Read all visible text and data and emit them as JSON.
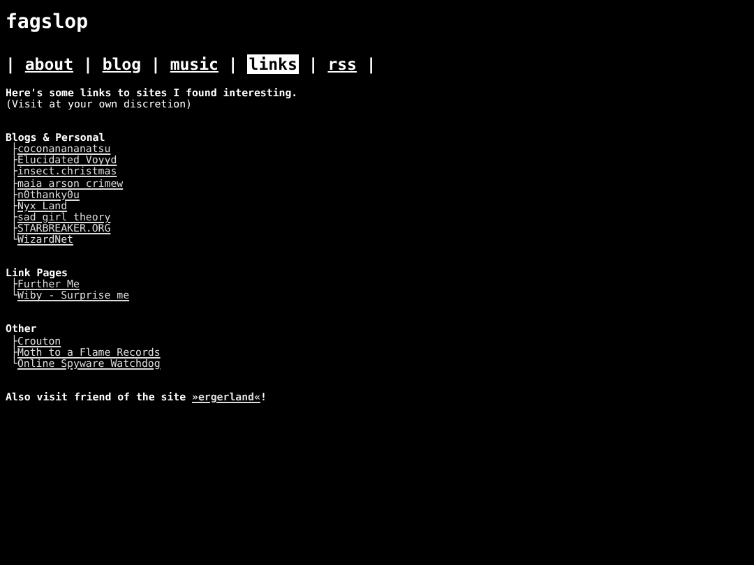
{
  "site_title": "fagslop",
  "nav": {
    "separator": "|",
    "items": [
      {
        "label": "about",
        "selected": false
      },
      {
        "label": "blog",
        "selected": false
      },
      {
        "label": "music",
        "selected": false
      },
      {
        "label": "links",
        "selected": true
      },
      {
        "label": "rss",
        "selected": false
      }
    ]
  },
  "intro": "Here's some links to sites I found interesting.",
  "note": "(Visit at your own discretion)",
  "sections": [
    {
      "heading": "Blogs & Personal",
      "links": [
        {
          "branch": "├",
          "label": "coconanananatsu"
        },
        {
          "branch": "├",
          "label": "Elucidated Voyyd"
        },
        {
          "branch": "├",
          "label": "insect.christmas"
        },
        {
          "branch": "├",
          "label": "maia arson crimew"
        },
        {
          "branch": "├",
          "label": "n0thanky0u"
        },
        {
          "branch": "├",
          "label": "Nyx Land"
        },
        {
          "branch": "├",
          "label": "sad girl theory"
        },
        {
          "branch": "├",
          "label": "STARBREAKER.ORG"
        },
        {
          "branch": "└",
          "label": "WizardNet"
        }
      ]
    },
    {
      "heading": "Link Pages",
      "links": [
        {
          "branch": "├",
          "label": "Further Me"
        },
        {
          "branch": "└",
          "label": "Wiby - Surprise me"
        }
      ]
    },
    {
      "heading": "Other",
      "links": [
        {
          "branch": "├",
          "label": "Crouton"
        },
        {
          "branch": "├",
          "label": "Moth to a Flame Records"
        },
        {
          "branch": "└",
          "label": "Online Spyware Watchdog"
        }
      ]
    }
  ],
  "footer": {
    "text": "Also visit friend of the site",
    "link": "»ergerland«",
    "end": "!"
  }
}
